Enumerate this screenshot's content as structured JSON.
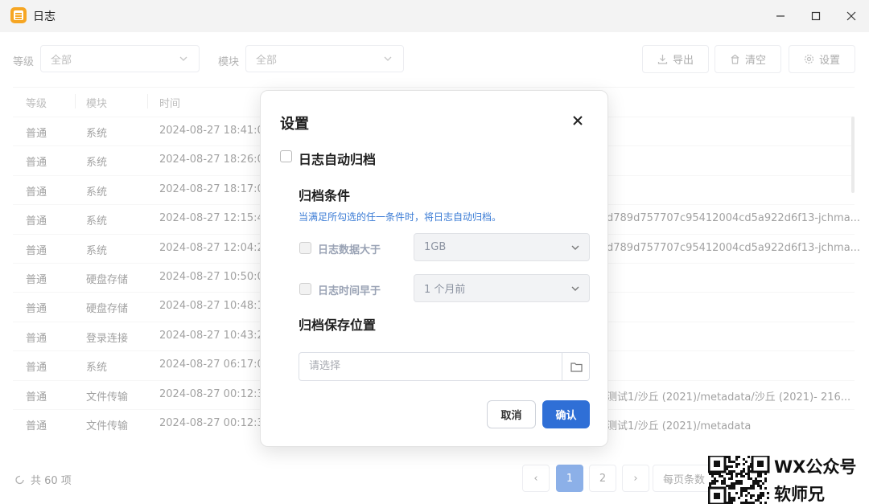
{
  "window": {
    "title": "日志",
    "controls": {
      "minimize": "—",
      "maximize": "☐",
      "close": "✕"
    }
  },
  "filters": {
    "level_label": "等级",
    "level_value": "全部",
    "module_label": "模块",
    "module_value": "全部"
  },
  "toolbar": {
    "export": "导出",
    "clear": "清空",
    "settings": "设置"
  },
  "table": {
    "columns": [
      "等级",
      "模块",
      "时间"
    ],
    "rows": [
      {
        "level": "普通",
        "module": "系统",
        "time": "2024-08-27 18:41:00",
        "detail": ""
      },
      {
        "level": "普通",
        "module": "系统",
        "time": "2024-08-27 18:26:00",
        "detail": ""
      },
      {
        "level": "普通",
        "module": "系统",
        "time": "2024-08-27 18:17:00",
        "detail": ""
      },
      {
        "level": "普通",
        "module": "系统",
        "time": "2024-08-27 12:15:48",
        "detail": "d789d757707c95412004cd5a922d6f13-jchma..."
      },
      {
        "level": "普通",
        "module": "系统",
        "time": "2024-08-27 12:04:29",
        "detail": "d789d757707c95412004cd5a922d6f13-jchma..."
      },
      {
        "level": "普通",
        "module": "硬盘存储",
        "time": "2024-08-27 10:50:06",
        "detail": ""
      },
      {
        "level": "普通",
        "module": "硬盘存储",
        "time": "2024-08-27 10:48:13",
        "detail": ""
      },
      {
        "level": "普通",
        "module": "登录连接",
        "time": "2024-08-27 10:43:28",
        "detail": ""
      },
      {
        "level": "普通",
        "module": "系统",
        "time": "2024-08-27 06:17:00",
        "detail": ""
      },
      {
        "level": "普通",
        "module": "文件传输",
        "time": "2024-08-27 00:12:34",
        "detail": "测试1/沙丘 (2021)/metadata/沙丘 (2021)- 216..."
      },
      {
        "level": "普通",
        "module": "文件传输",
        "time": "2024-08-27 00:12:34",
        "detail": "测试1/沙丘 (2021)/metadata"
      }
    ]
  },
  "footer": {
    "total": "共 60 项",
    "pages": [
      "1",
      "2"
    ],
    "prev": "‹",
    "next": "›",
    "page_size": "每页条数"
  },
  "dialog": {
    "title": "设置",
    "auto_archive_label": "日志自动归档",
    "conditions_title": "归档条件",
    "conditions_hint": "当满足所勾选的任一条件时，将日志自动归档。",
    "size_label": "日志数据大于",
    "size_value": "1GB",
    "age_label": "日志时间早于",
    "age_value": "1 个月前",
    "location_title": "归档保存位置",
    "location_placeholder": "请选择",
    "cancel": "取消",
    "confirm": "确认"
  },
  "watermark": {
    "line1": "WX公众号",
    "line2": "软师兄"
  }
}
